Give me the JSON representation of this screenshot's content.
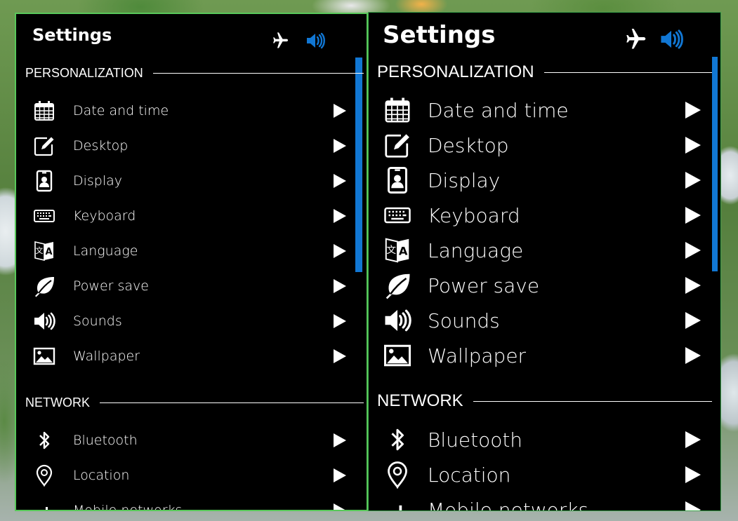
{
  "panels": [
    {
      "title": "Settings",
      "status_icons": [
        "airplane-icon",
        "volume-icon"
      ],
      "accent_color": "#1177d4",
      "sections": [
        {
          "heading": "PERSONALIZATION",
          "items": [
            {
              "label": "Date and time",
              "icon": "calendar-icon"
            },
            {
              "label": "Desktop",
              "icon": "edit-icon"
            },
            {
              "label": "Display",
              "icon": "display-icon"
            },
            {
              "label": "Keyboard",
              "icon": "keyboard-icon"
            },
            {
              "label": "Language",
              "icon": "language-icon"
            },
            {
              "label": "Power save",
              "icon": "leaf-icon"
            },
            {
              "label": "Sounds",
              "icon": "speaker-icon"
            },
            {
              "label": "Wallpaper",
              "icon": "image-icon"
            }
          ]
        },
        {
          "heading": "NETWORK",
          "items": [
            {
              "label": "Bluetooth",
              "icon": "bluetooth-icon"
            },
            {
              "label": "Location",
              "icon": "location-pin-icon"
            },
            {
              "label": "Mobile networks",
              "icon": "signal-bars-icon"
            }
          ]
        }
      ]
    },
    {
      "title": "Settings",
      "status_icons": [
        "airplane-icon",
        "volume-icon"
      ],
      "accent_color": "#1177d4",
      "sections": [
        {
          "heading": "PERSONALIZATION",
          "items": [
            {
              "label": "Date and time",
              "icon": "calendar-icon"
            },
            {
              "label": "Desktop",
              "icon": "edit-icon"
            },
            {
              "label": "Display",
              "icon": "display-icon"
            },
            {
              "label": "Keyboard",
              "icon": "keyboard-icon"
            },
            {
              "label": "Language",
              "icon": "language-icon"
            },
            {
              "label": "Power save",
              "icon": "leaf-icon"
            },
            {
              "label": "Sounds",
              "icon": "speaker-icon"
            },
            {
              "label": "Wallpaper",
              "icon": "image-icon"
            }
          ]
        },
        {
          "heading": "NETWORK",
          "items": [
            {
              "label": "Bluetooth",
              "icon": "bluetooth-icon"
            },
            {
              "label": "Location",
              "icon": "location-pin-icon"
            },
            {
              "label": "Mobile networks",
              "icon": "signal-bars-icon"
            }
          ]
        }
      ]
    }
  ]
}
